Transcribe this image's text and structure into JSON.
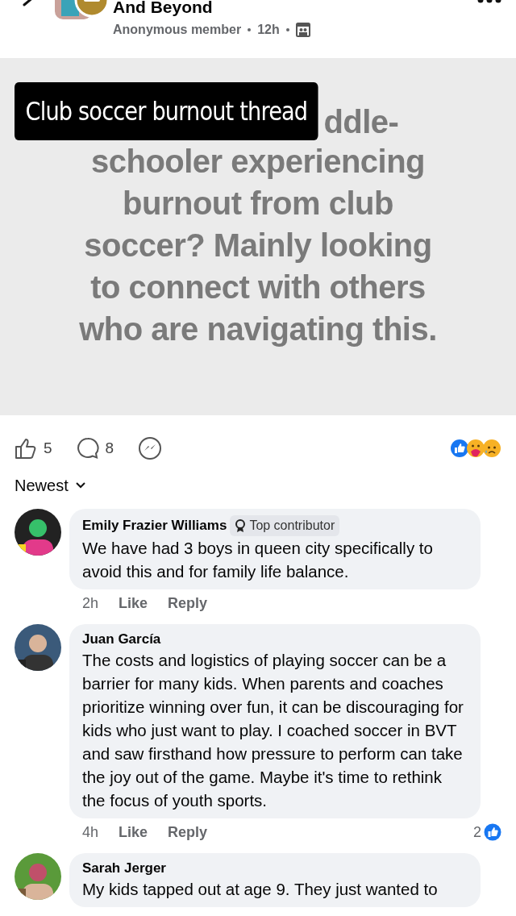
{
  "header": {
    "title": "And Beyond",
    "author": "Anonymous member",
    "time": "12h"
  },
  "post": {
    "caption": "Club soccer burnout thread",
    "lines": [
      "ddle-",
      "schooler experiencing",
      "burnout from club",
      "soccer? Mainly looking",
      "to connect with others",
      "who are navigating this."
    ]
  },
  "actions": {
    "likes": "5",
    "comments": "8"
  },
  "sort": {
    "label": "Newest"
  },
  "comments": [
    {
      "name": "Emily Frazier Williams",
      "badge": "Top contributor",
      "text": "We have had 3 boys in queen city specifically to avoid this and for family life balance.",
      "time": "2h",
      "like": "Like",
      "reply": "Reply"
    },
    {
      "name": "Juan García",
      "text": "The costs and logistics of playing soccer can be a barrier for many kids. When parents and coaches prioritize winning over fun, it can be discouraging for kids who just want to play. I coached soccer in BVT and saw firsthand how pressure to perform can take the joy out of the game. Maybe it's time to rethink the focus of youth sports.",
      "time": "4h",
      "like": "Like",
      "reply": "Reply",
      "reaction_count": "2"
    },
    {
      "name": "Sarah Jerger",
      "text": "My kids tapped out at age 9. They just wanted to"
    }
  ]
}
